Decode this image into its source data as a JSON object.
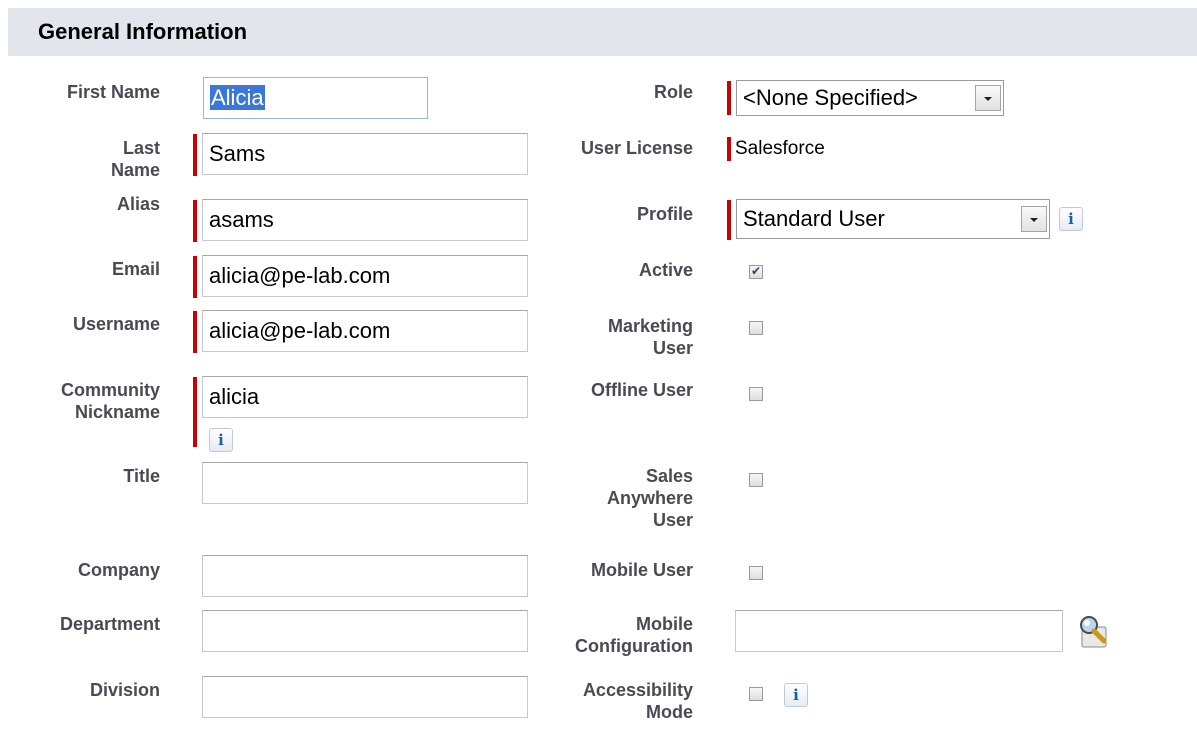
{
  "section": {
    "title": "General Information"
  },
  "left_fields": {
    "first_name": {
      "label": "First Name",
      "value": "Alicia"
    },
    "last_name": {
      "label_line1": "Last",
      "label_line2": "Name",
      "value": "Sams"
    },
    "alias": {
      "label": "Alias",
      "value": "asams"
    },
    "email": {
      "label": "Email",
      "value": "alicia@pe-lab.com"
    },
    "username": {
      "label": "Username",
      "value": "alicia@pe-lab.com"
    },
    "community_nickname": {
      "label_line1": "Community",
      "label_line2": "Nickname",
      "value": "alicia"
    },
    "title": {
      "label": "Title",
      "value": ""
    },
    "company": {
      "label": "Company",
      "value": ""
    },
    "department": {
      "label": "Department",
      "value": ""
    },
    "division": {
      "label": "Division",
      "value": ""
    }
  },
  "right_fields": {
    "role": {
      "label": "Role",
      "value": "<None Specified>"
    },
    "user_license": {
      "label": "User License",
      "value": "Salesforce"
    },
    "profile": {
      "label": "Profile",
      "value": "Standard User"
    },
    "active": {
      "label": "Active",
      "checked": true
    },
    "marketing_user": {
      "label_line1": "Marketing",
      "label_line2": "User",
      "checked": false
    },
    "offline_user": {
      "label": "Offline User",
      "checked": false
    },
    "sales_anywhere_user": {
      "label_line1": "Sales",
      "label_line2": "Anywhere",
      "label_line3": "User",
      "checked": false
    },
    "mobile_user": {
      "label": "Mobile User",
      "checked": false
    },
    "mobile_configuration": {
      "label_line1": "Mobile",
      "label_line2": "Configuration",
      "value": ""
    },
    "accessibility_mode": {
      "label_line1": "Accessibility",
      "label_line2": "Mode",
      "checked": false
    }
  },
  "icons": {
    "info": "i",
    "lookup": "lookup-magnifier-icon"
  },
  "colors": {
    "required": "#cc0000",
    "header_bg": "#e3e5ec",
    "label": "#4a4a56",
    "selection": "#3b77d8"
  }
}
